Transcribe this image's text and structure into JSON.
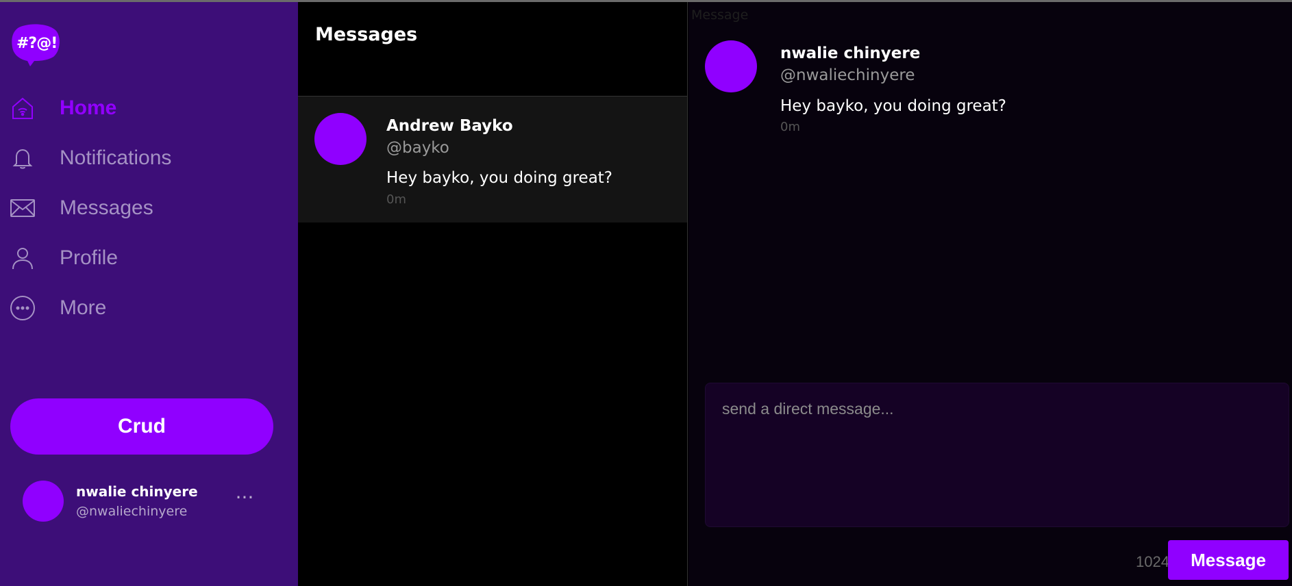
{
  "logo": {
    "text": "#?@!"
  },
  "nav": {
    "items": [
      {
        "label": "Home",
        "icon": "home-icon",
        "active": true
      },
      {
        "label": "Notifications",
        "icon": "bell-icon"
      },
      {
        "label": "Messages",
        "icon": "envelope-icon"
      },
      {
        "label": "Profile",
        "icon": "user-icon"
      },
      {
        "label": "More",
        "icon": "more-circle-icon"
      }
    ],
    "crud_label": "Crud"
  },
  "current_user": {
    "name": "nwalie chinyere",
    "handle": "@nwaliechinyere",
    "more": "···"
  },
  "list": {
    "title": "Messages",
    "conversations": [
      {
        "name": "Andrew Bayko",
        "handle": "@bayko",
        "text": "Hey bayko, you doing great?",
        "time": "0m"
      }
    ]
  },
  "chat": {
    "overlay_label": "Message",
    "messages": [
      {
        "name": "nwalie chinyere",
        "handle": "@nwaliechinyere",
        "text": "Hey bayko, you doing great?",
        "time": "0m"
      }
    ],
    "compose_placeholder": "send a direct message...",
    "char_count": "1024",
    "send_label": "Message"
  },
  "colors": {
    "accent": "#9000ff",
    "sidebar": "#3d0e78",
    "inactive_nav": "#a592c4"
  }
}
